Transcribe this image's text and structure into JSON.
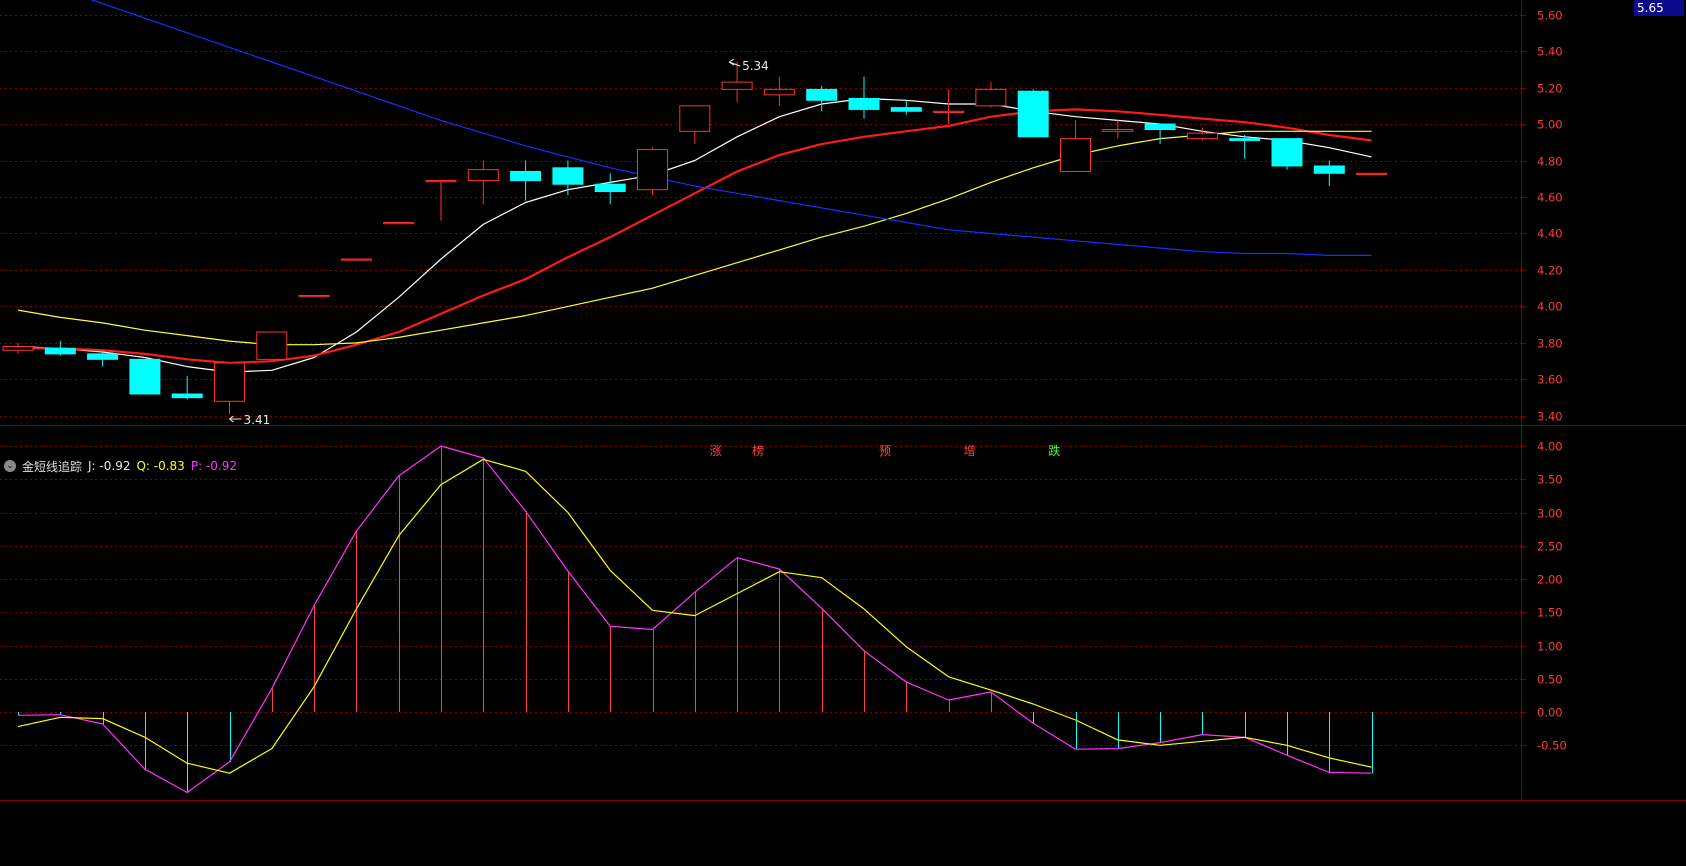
{
  "colors": {
    "background": "#000000",
    "grid": "#8b0000",
    "axis_text": "#ff3b3b",
    "up_candle": "#ff3030",
    "down_candle": "#00ffff",
    "ma_white": "#ffffff",
    "ma_red": "#ff1a1a",
    "ma_yellow": "#ffff33",
    "trend_blue": "#1c2cff",
    "ind_j": "#ff33ff",
    "ind_q": "#ffff00",
    "hist_pos": "#ff4040",
    "hist_neg": "#00ffff"
  },
  "price_tag": "5.65",
  "price_axis_ticks": [
    "5.60",
    "5.40",
    "5.20",
    "5.00",
    "4.80",
    "4.60",
    "4.40",
    "4.20",
    "4.00",
    "3.80",
    "3.60",
    "3.40"
  ],
  "indicator_axis_ticks": [
    "4.00",
    "3.50",
    "3.00",
    "2.50",
    "2.00",
    "1.50",
    "1.00",
    "0.50",
    "0.00",
    "-0.50"
  ],
  "annotations": {
    "high_label": "5.34",
    "low_label": "3.41"
  },
  "event_markers": [
    {
      "text": "涨",
      "color": "#ff4040",
      "index": 16
    },
    {
      "text": "榜",
      "color": "#ff4040",
      "index": 17
    },
    {
      "text": "预",
      "color": "#ff4040",
      "index": 20
    },
    {
      "text": "增",
      "color": "#ff4040",
      "index": 22
    },
    {
      "text": "跌",
      "color": "#33ff33",
      "index": 24
    }
  ],
  "indicator_legend": {
    "name": "金短线追踪",
    "j_label": "J: -0.92",
    "q_label": "Q: -0.83",
    "p_label": "P: -0.92"
  },
  "chart_data": [
    {
      "type": "candlestick",
      "ylim": [
        3.35,
        5.68
      ],
      "candles": [
        {
          "o": 3.76,
          "h": 3.8,
          "l": 3.74,
          "c": 3.78
        },
        {
          "o": 3.77,
          "h": 3.81,
          "l": 3.73,
          "c": 3.74
        },
        {
          "o": 3.74,
          "h": 3.75,
          "l": 3.67,
          "c": 3.71
        },
        {
          "o": 3.71,
          "h": 3.71,
          "l": 3.52,
          "c": 3.52
        },
        {
          "o": 3.52,
          "h": 3.62,
          "l": 3.49,
          "c": 3.5
        },
        {
          "o": 3.48,
          "h": 3.69,
          "l": 3.41,
          "c": 3.69
        },
        {
          "o": 3.71,
          "h": 3.86,
          "l": 3.7,
          "c": 3.86
        },
        {
          "o": 4.06,
          "h": 4.06,
          "l": 4.06,
          "c": 4.06
        },
        {
          "o": 4.26,
          "h": 4.26,
          "l": 4.26,
          "c": 4.26
        },
        {
          "o": 4.46,
          "h": 4.46,
          "l": 4.46,
          "c": 4.46
        },
        {
          "o": 4.69,
          "h": 4.69,
          "l": 4.47,
          "c": 4.69
        },
        {
          "o": 4.69,
          "h": 4.8,
          "l": 4.56,
          "c": 4.75
        },
        {
          "o": 4.74,
          "h": 4.8,
          "l": 4.58,
          "c": 4.69
        },
        {
          "o": 4.76,
          "h": 4.8,
          "l": 4.61,
          "c": 4.67
        },
        {
          "o": 4.67,
          "h": 4.73,
          "l": 4.56,
          "c": 4.63
        },
        {
          "o": 4.64,
          "h": 4.87,
          "l": 4.61,
          "c": 4.86
        },
        {
          "o": 4.96,
          "h": 5.1,
          "l": 4.89,
          "c": 5.1
        },
        {
          "o": 5.19,
          "h": 5.34,
          "l": 5.12,
          "c": 5.23
        },
        {
          "o": 5.16,
          "h": 5.26,
          "l": 5.1,
          "c": 5.19
        },
        {
          "o": 5.19,
          "h": 5.21,
          "l": 5.07,
          "c": 5.13
        },
        {
          "o": 5.14,
          "h": 5.26,
          "l": 5.03,
          "c": 5.08
        },
        {
          "o": 5.09,
          "h": 5.13,
          "l": 5.05,
          "c": 5.07
        },
        {
          "o": 5.07,
          "h": 5.19,
          "l": 5.0,
          "c": 5.07
        },
        {
          "o": 5.1,
          "h": 5.23,
          "l": 5.09,
          "c": 5.19
        },
        {
          "o": 5.18,
          "h": 5.19,
          "l": 4.93,
          "c": 4.93
        },
        {
          "o": 4.74,
          "h": 5.02,
          "l": 4.74,
          "c": 4.92
        },
        {
          "o": 4.96,
          "h": 5.02,
          "l": 4.92,
          "c": 4.97
        },
        {
          "o": 5.0,
          "h": 5.0,
          "l": 4.89,
          "c": 4.97
        },
        {
          "o": 4.92,
          "h": 4.98,
          "l": 4.91,
          "c": 4.95
        },
        {
          "o": 4.92,
          "h": 4.94,
          "l": 4.81,
          "c": 4.91
        },
        {
          "o": 4.92,
          "h": 4.92,
          "l": 4.75,
          "c": 4.77
        },
        {
          "o": 4.77,
          "h": 4.8,
          "l": 4.66,
          "c": 4.73
        },
        {
          "o": 4.73,
          "h": 4.73,
          "l": 4.73,
          "c": 4.73
        }
      ],
      "overlays": [
        {
          "color_key": "ma_white",
          "width": 1.2,
          "values": [
            3.78,
            3.77,
            3.75,
            3.72,
            3.67,
            3.64,
            3.65,
            3.72,
            3.86,
            4.05,
            4.26,
            4.45,
            4.57,
            4.64,
            4.68,
            4.72,
            4.8,
            4.93,
            5.04,
            5.11,
            5.14,
            5.13,
            5.11,
            5.11,
            5.07,
            5.04,
            5.02,
            5.0,
            4.96,
            4.93,
            4.91,
            4.87,
            4.82
          ]
        },
        {
          "color_key": "ma_red",
          "width": 2.2,
          "values": [
            3.77,
            3.77,
            3.76,
            3.74,
            3.71,
            3.69,
            3.7,
            3.73,
            3.79,
            3.86,
            3.96,
            4.06,
            4.15,
            4.27,
            4.38,
            4.5,
            4.62,
            4.74,
            4.83,
            4.89,
            4.93,
            4.96,
            4.99,
            5.04,
            5.07,
            5.08,
            5.07,
            5.05,
            5.03,
            5.01,
            4.98,
            4.94,
            4.91
          ]
        },
        {
          "color_key": "ma_yellow",
          "width": 1.2,
          "values": [
            3.98,
            3.94,
            3.91,
            3.87,
            3.84,
            3.81,
            3.79,
            3.79,
            3.8,
            3.83,
            3.87,
            3.91,
            3.95,
            4.0,
            4.05,
            4.1,
            4.17,
            4.24,
            4.31,
            4.38,
            4.44,
            4.51,
            4.59,
            4.68,
            4.76,
            4.83,
            4.88,
            4.92,
            4.94,
            4.96,
            4.96,
            4.96,
            4.96
          ]
        },
        {
          "color_key": "trend_blue",
          "width": 1.2,
          "values": [
            5.82,
            5.74,
            5.66,
            5.58,
            5.5,
            5.42,
            5.34,
            5.26,
            5.18,
            5.1,
            5.02,
            4.95,
            4.88,
            4.82,
            4.76,
            4.71,
            4.66,
            4.62,
            4.58,
            4.54,
            4.5,
            4.46,
            4.42,
            4.4,
            4.38,
            4.36,
            4.34,
            4.32,
            4.3,
            4.29,
            4.29,
            4.28,
            4.28
          ]
        }
      ]
    },
    {
      "type": "line",
      "ylim": [
        -1.0,
        4.15
      ],
      "series": [
        {
          "color_key": "ind_j",
          "values": [
            -0.05,
            -0.04,
            -0.18,
            -0.86,
            -1.21,
            -0.75,
            0.35,
            1.6,
            2.72,
            3.55,
            4.0,
            3.82,
            3.02,
            2.12,
            1.29,
            1.24,
            1.8,
            2.32,
            2.15,
            1.56,
            0.92,
            0.45,
            0.18,
            0.3,
            -0.17,
            -0.56,
            -0.55,
            -0.46,
            -0.34,
            -0.38,
            -0.65,
            -0.91,
            -0.92
          ]
        },
        {
          "color_key": "ind_q",
          "values": [
            -0.22,
            -0.08,
            -0.1,
            -0.38,
            -0.77,
            -0.92,
            -0.55,
            0.38,
            1.55,
            2.65,
            3.42,
            3.8,
            3.62,
            3.0,
            2.13,
            1.53,
            1.45,
            1.78,
            2.11,
            2.02,
            1.55,
            0.98,
            0.53,
            0.33,
            0.12,
            -0.12,
            -0.42,
            -0.5,
            -0.44,
            -0.38,
            -0.5,
            -0.69,
            -0.83
          ]
        }
      ]
    }
  ]
}
